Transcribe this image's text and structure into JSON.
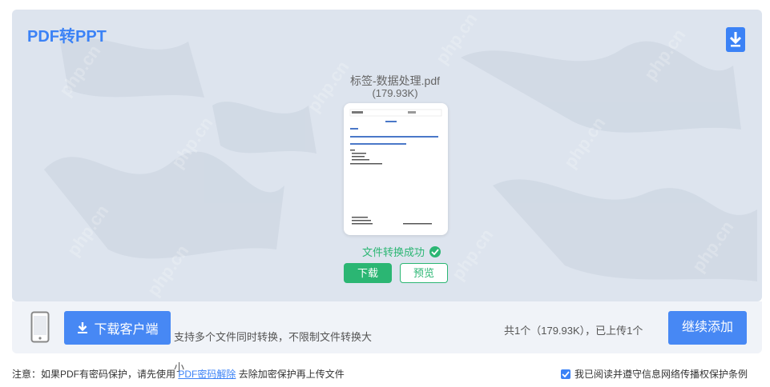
{
  "header": {
    "title": "PDF转PPT",
    "download_icon": "download-icon"
  },
  "file": {
    "name": "标签-数据处理.pdf",
    "size": "(179.93K)",
    "status": "文件转换成功",
    "download_label": "下载",
    "preview_label": "预览"
  },
  "bottom_bar": {
    "phone_icon": "phone-icon",
    "client_button": "下载客户端",
    "support_text_line1": "支持多个文件同时转换，不限制文件转换大",
    "support_text_line2": "小",
    "count_text": "共1个（179.93K），已上传1个",
    "continue_button": "继续添加"
  },
  "footer": {
    "notice_prefix": "注意：如果PDF有密码保护，请先使用",
    "notice_link": "PDF密码解除",
    "notice_suffix": "去除加密保护再上传文件",
    "agree_text": "我已阅读并遵守信息网络传播权保护条例",
    "agree_checked": true
  },
  "colors": {
    "accent": "#3b82f6",
    "success": "#2bb673",
    "button_blue": "#4788f4"
  }
}
